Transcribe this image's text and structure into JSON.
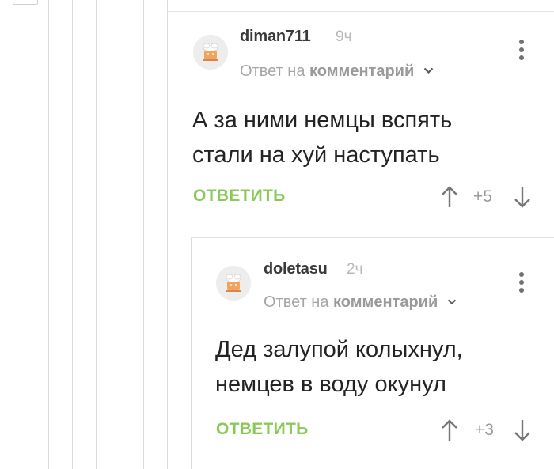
{
  "comments": [
    {
      "author": "diman711",
      "time": "9ч",
      "reply_prefix": "Ответ на",
      "reply_target": "комментарий",
      "text_line1": "А за ними немцы вспять",
      "text_line2": "стали на хуй наступать",
      "reply_label": "ОТВЕТИТЬ",
      "rating": "+5"
    },
    {
      "author": "doletasu",
      "time": "2ч",
      "reply_prefix": "Ответ на",
      "reply_target": "комментарий",
      "text_line1": "Дед залупой колыхнул,",
      "text_line2": "немцев в воду окунул",
      "reply_label": "ОТВЕТИТЬ",
      "rating": "+3"
    }
  ],
  "icons": {
    "avatar": "default-avatar-icon",
    "menu": "kebab-menu-icon",
    "up": "arrow-up-icon",
    "down": "arrow-down-icon",
    "expand": "chevron-down-icon"
  },
  "colors": {
    "reply_button": "#8ac858",
    "thread_line": "#dcdcdc"
  }
}
